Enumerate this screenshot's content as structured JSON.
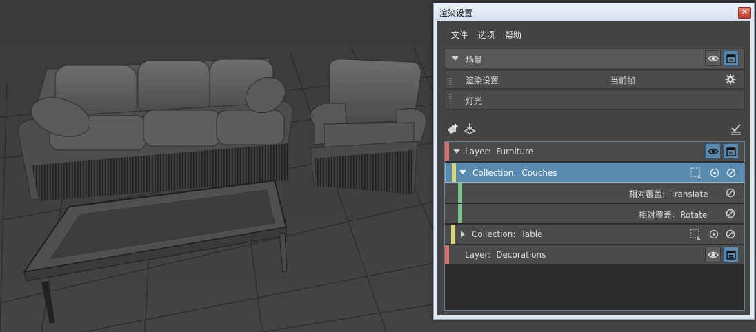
{
  "window": {
    "title": "渲染设置",
    "close": "✕"
  },
  "menu": [
    "文件",
    "选项",
    "帮助"
  ],
  "scene": {
    "header": "场景",
    "rows": [
      {
        "label": "渲染设置",
        "value": "当前帧"
      },
      {
        "label": "灯光"
      }
    ]
  },
  "layers": [
    {
      "kind": "Layer",
      "prefix": "Layer:",
      "name": "Furniture",
      "expanded": true,
      "color": "#d96b6b"
    },
    {
      "kind": "Collection",
      "prefix": "Collection:",
      "name": "Couches",
      "expanded": true,
      "selected": true,
      "color": "#d8d27a"
    },
    {
      "kind": "Override",
      "prefix": "相对覆盖:",
      "name": "Translate",
      "color": "#7cc48b"
    },
    {
      "kind": "Override",
      "prefix": "相对覆盖:",
      "name": "Rotate",
      "color": "#7cc48b"
    },
    {
      "kind": "Collection",
      "prefix": "Collection:",
      "name": "Table",
      "expanded": false,
      "color": "#d8d27a"
    },
    {
      "kind": "Layer",
      "prefix": "Layer:",
      "name": "Decorations",
      "expanded": false,
      "color": "#d96b6b"
    }
  ],
  "icons": {
    "visibility": "eye-icon",
    "renderable": "clapboard-icon",
    "settings": "gear-icon",
    "create_layer": "add-layer-icon",
    "import": "import-icon",
    "render_check": "render-check-icon",
    "isolate": "isolate-icon",
    "disable": "disable-icon",
    "select_members": "select-members-icon"
  },
  "colors": {
    "accent": "#5889ae",
    "layer": "#d96b6b",
    "collection": "#d8d27a",
    "override": "#7cc48b"
  }
}
